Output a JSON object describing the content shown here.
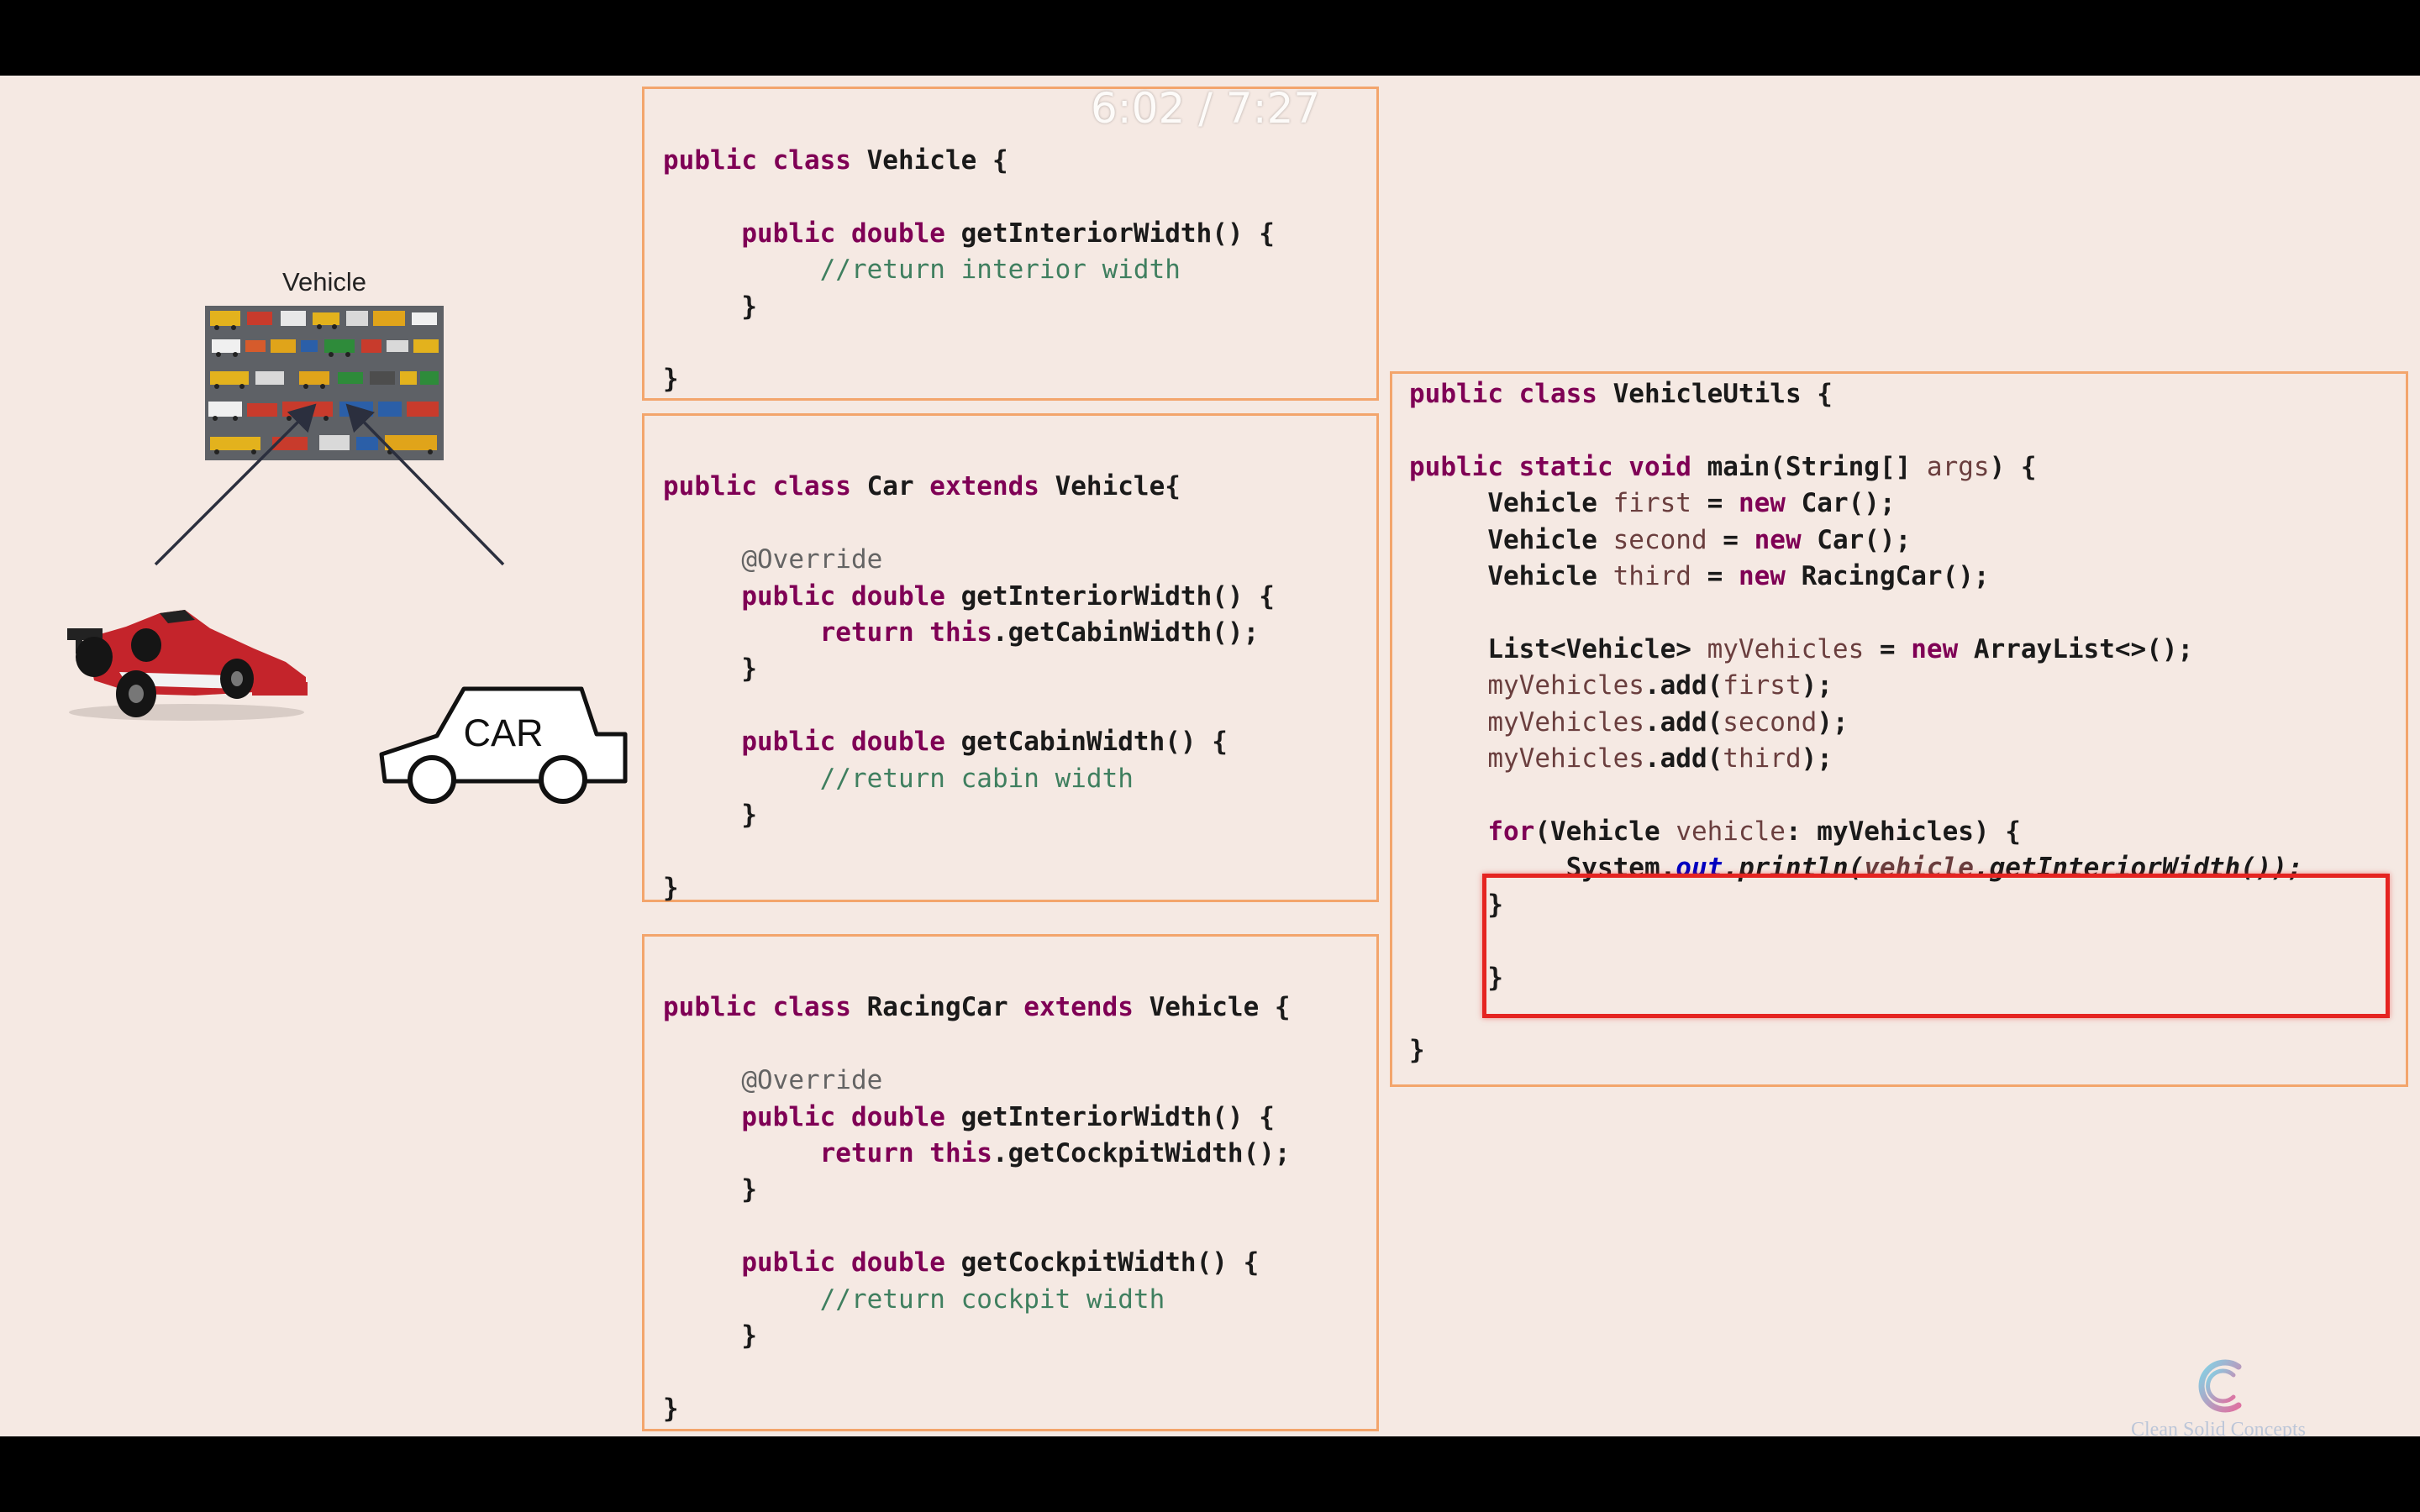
{
  "video": {
    "timestamp": "6:02 / 7:27"
  },
  "diagram": {
    "parent_caption": "Vehicle",
    "car_label": "CAR"
  },
  "branding": {
    "logo_text": "Clean Solid Concepts"
  },
  "code_blocks": {
    "vehicle": [
      [
        [
          "kw",
          "public class "
        ],
        [
          "t",
          "Vehicle {"
        ]
      ],
      [],
      [
        [
          "t",
          "     "
        ],
        [
          "kw",
          "public double "
        ],
        [
          "t",
          "getInteriorWidth() {"
        ]
      ],
      [
        [
          "t",
          "          "
        ],
        [
          "cm",
          "//return interior width"
        ]
      ],
      [
        [
          "t",
          "     }"
        ]
      ],
      [],
      [
        [
          "t",
          "}"
        ]
      ]
    ],
    "car": [
      [],
      [
        [
          "kw",
          "public class "
        ],
        [
          "t",
          "Car "
        ],
        [
          "kw",
          "extends "
        ],
        [
          "t",
          "Vehicle{"
        ]
      ],
      [],
      [
        [
          "t",
          "     "
        ],
        [
          "an",
          "@Override"
        ]
      ],
      [
        [
          "t",
          "     "
        ],
        [
          "kw",
          "public double "
        ],
        [
          "t",
          "getInteriorWidth() {"
        ]
      ],
      [
        [
          "t",
          "          "
        ],
        [
          "kw",
          "return this"
        ],
        [
          "t",
          ".getCabinWidth();"
        ]
      ],
      [
        [
          "t",
          "     }"
        ]
      ],
      [],
      [
        [
          "t",
          "     "
        ],
        [
          "kw",
          "public double "
        ],
        [
          "t",
          "getCabinWidth() {"
        ]
      ],
      [
        [
          "t",
          "          "
        ],
        [
          "cm",
          "//return cabin width"
        ]
      ],
      [
        [
          "t",
          "     }"
        ]
      ],
      [],
      [
        [
          "t",
          "}"
        ]
      ]
    ],
    "racing_car": [
      [],
      [
        [
          "kw",
          "public class "
        ],
        [
          "t",
          "RacingCar "
        ],
        [
          "kw",
          "extends "
        ],
        [
          "t",
          "Vehicle {"
        ]
      ],
      [],
      [
        [
          "t",
          "     "
        ],
        [
          "an",
          "@Override"
        ]
      ],
      [
        [
          "t",
          "     "
        ],
        [
          "kw",
          "public double "
        ],
        [
          "t",
          "getInteriorWidth() {"
        ]
      ],
      [
        [
          "t",
          "          "
        ],
        [
          "kw",
          "return this"
        ],
        [
          "t",
          ".getCockpitWidth();"
        ]
      ],
      [
        [
          "t",
          "     }"
        ]
      ],
      [],
      [
        [
          "t",
          "     "
        ],
        [
          "kw",
          "public double "
        ],
        [
          "t",
          "getCockpitWidth() {"
        ]
      ],
      [
        [
          "t",
          "          "
        ],
        [
          "cm",
          "//return cockpit width"
        ]
      ],
      [
        [
          "t",
          "     }"
        ]
      ],
      [],
      [
        [
          "t",
          "}"
        ]
      ]
    ],
    "vehicle_utils": [
      [
        [
          "kw",
          "public class "
        ],
        [
          "t",
          "VehicleUtils {"
        ]
      ],
      [],
      [
        [
          "kw",
          "public static void "
        ],
        [
          "t",
          "main(String[] "
        ],
        [
          "vr",
          "args"
        ],
        [
          "t",
          ") {"
        ]
      ],
      [
        [
          "t",
          "     Vehicle "
        ],
        [
          "vr",
          "first"
        ],
        [
          "t",
          " = "
        ],
        [
          "kw",
          "new "
        ],
        [
          "t",
          "Car();"
        ]
      ],
      [
        [
          "t",
          "     Vehicle "
        ],
        [
          "vr",
          "second"
        ],
        [
          "t",
          " = "
        ],
        [
          "kw",
          "new "
        ],
        [
          "t",
          "Car();"
        ]
      ],
      [
        [
          "t",
          "     Vehicle "
        ],
        [
          "vr",
          "third"
        ],
        [
          "t",
          " = "
        ],
        [
          "kw",
          "new "
        ],
        [
          "t",
          "RacingCar();"
        ]
      ],
      [],
      [
        [
          "t",
          "     List<Vehicle> "
        ],
        [
          "vr",
          "myVehicles"
        ],
        [
          "t",
          " = "
        ],
        [
          "kw",
          "new "
        ],
        [
          "t",
          "ArrayList<>();"
        ]
      ],
      [
        [
          "t",
          "     "
        ],
        [
          "vr",
          "myVehicles"
        ],
        [
          "t",
          ".add("
        ],
        [
          "vr",
          "first"
        ],
        [
          "t",
          ");"
        ]
      ],
      [
        [
          "t",
          "     "
        ],
        [
          "vr",
          "myVehicles"
        ],
        [
          "t",
          ".add("
        ],
        [
          "vr",
          "second"
        ],
        [
          "t",
          ");"
        ]
      ],
      [
        [
          "t",
          "     "
        ],
        [
          "vr",
          "myVehicles"
        ],
        [
          "t",
          ".add("
        ],
        [
          "vr",
          "third"
        ],
        [
          "t",
          ");"
        ]
      ],
      [],
      [
        [
          "t",
          "     "
        ],
        [
          "kw",
          "for"
        ],
        [
          "t",
          "(Vehicle "
        ],
        [
          "vr",
          "vehicle"
        ],
        [
          "t",
          ": myVehicles) {"
        ]
      ],
      [
        [
          "t",
          "          System."
        ],
        [
          "fd",
          "out"
        ],
        [
          "it",
          ".println("
        ],
        [
          "itv",
          "vehicle"
        ],
        [
          "it",
          ".getInteriorWidth());"
        ]
      ],
      [
        [
          "t",
          "     }"
        ]
      ],
      [],
      [
        [
          "t",
          "     }"
        ]
      ],
      [],
      [
        [
          "t",
          "}"
        ]
      ]
    ]
  }
}
